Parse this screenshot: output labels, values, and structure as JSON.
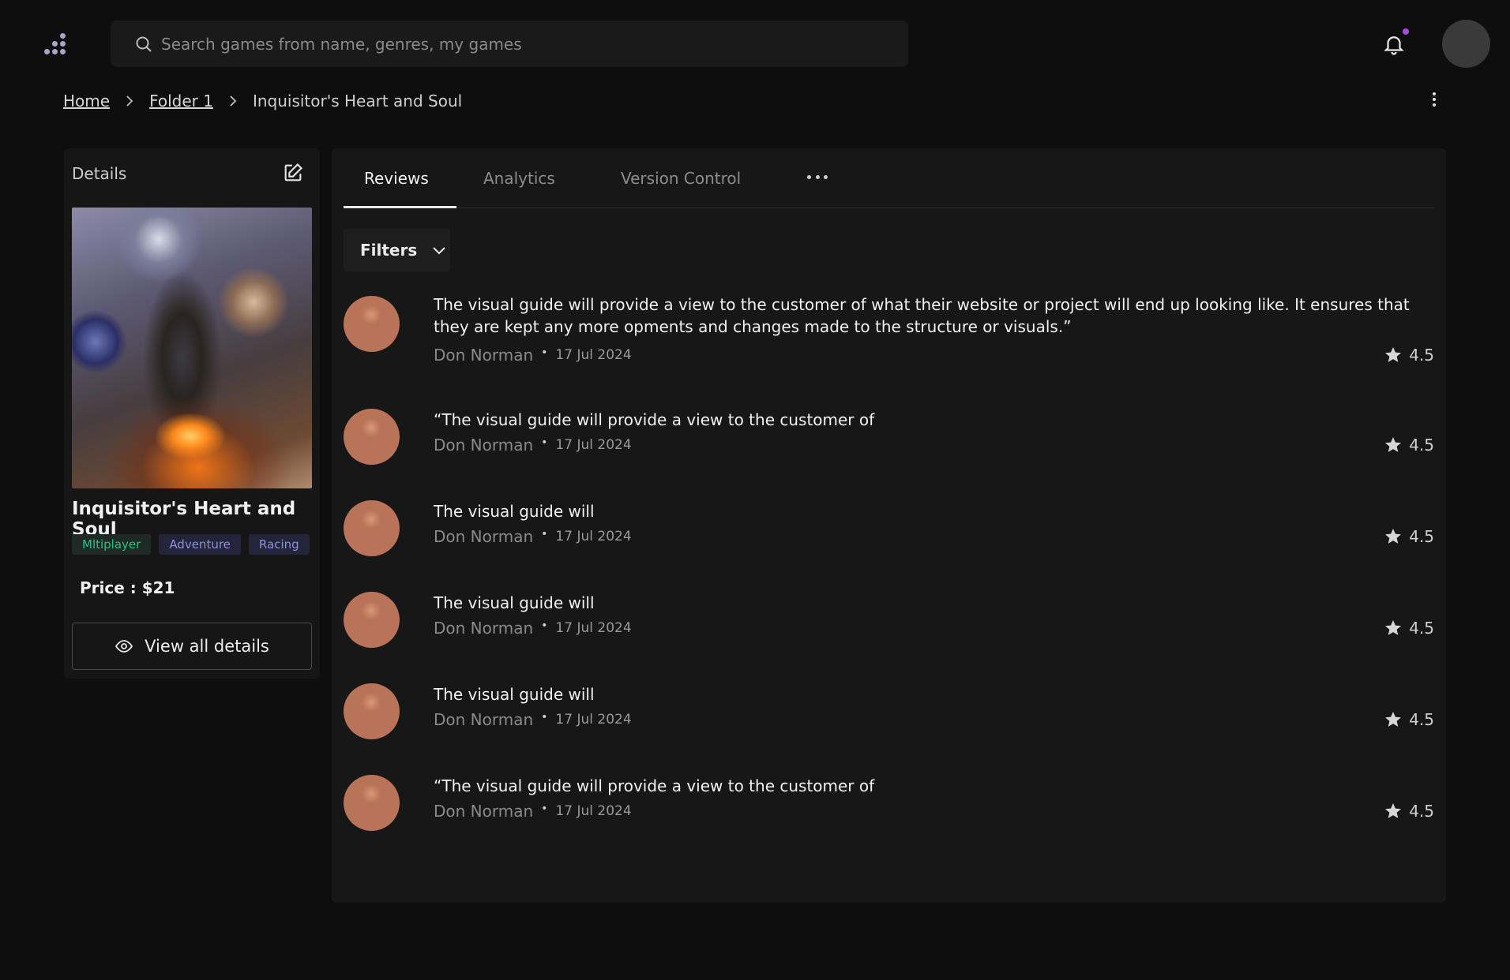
{
  "header": {
    "search_placeholder": "Search games from name, genres, my games",
    "notification_dot_color": "#a64bdc",
    "logo_icon": "dots-logo-icon",
    "bell_icon": "bell-icon"
  },
  "breadcrumb": {
    "home": "Home",
    "folder": "Folder 1",
    "current": "Inquisitor's Heart and Soul"
  },
  "details": {
    "title": "Details",
    "game_title": "Inquisitor's Heart and Soul",
    "tags": [
      "Mltiplayer",
      "Adventure",
      "Racing"
    ],
    "price_label": "Price",
    "price_value": ": $21",
    "view_all_label": "View all details"
  },
  "tabs": {
    "reviews": "Reviews",
    "analytics": "Analytics",
    "version_control": "Version Control",
    "active": "Reviews"
  },
  "filters_label": "Filters",
  "reviews": [
    {
      "text": "The visual guide will provide a view to the customer of what their website or project will end up looking like. It ensures that they are kept any more   opments and changes made to the structure or visuals.”",
      "author": "Don Norman",
      "date": "17 Jul 2024",
      "rating": "4.5"
    },
    {
      "text": "“The visual guide will provide a view to the customer of",
      "author": "Don Norman",
      "date": "17 Jul 2024",
      "rating": "4.5"
    },
    {
      "text": "The visual guide will",
      "author": "Don Norman",
      "date": "17 Jul 2024",
      "rating": "4.5"
    },
    {
      "text": "The visual guide will",
      "author": "Don Norman",
      "date": "17 Jul 2024",
      "rating": "4.5"
    },
    {
      "text": "The visual guide will",
      "author": "Don Norman",
      "date": "17 Jul 2024",
      "rating": "4.5"
    },
    {
      "text": "“The visual guide will provide a view to the customer of",
      "author": "Don Norman",
      "date": "17 Jul 2024",
      "rating": "4.5"
    }
  ],
  "colors": {
    "background": "#0e0e0f",
    "card": "#171718",
    "tag_green": "#2fbf81",
    "tag_blue": "#8b8fe0"
  }
}
